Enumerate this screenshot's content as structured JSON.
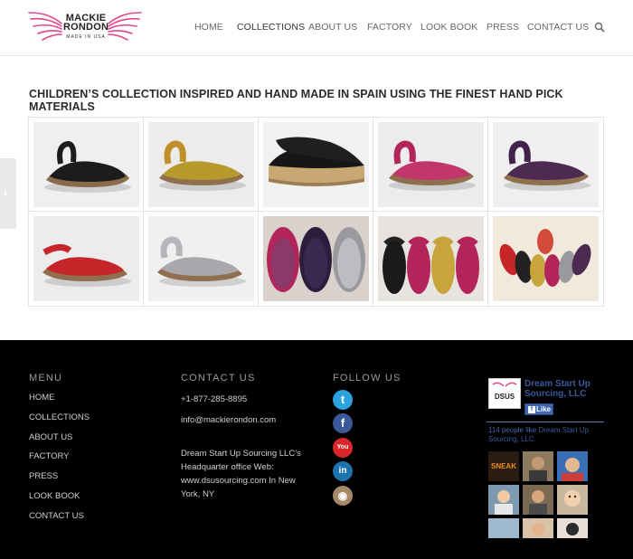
{
  "brand": {
    "line1": "MACKIE",
    "line2": "RONDON",
    "line3": "MADE IN USA",
    "accent": "#e0448d"
  },
  "nav": {
    "items": [
      {
        "label": "HOME",
        "active": false
      },
      {
        "label": "COLLECTIONS",
        "active": true
      },
      {
        "label": "ABOUT US",
        "active": false
      },
      {
        "label": "FACTORY",
        "active": false
      },
      {
        "label": "LOOK BOOK",
        "active": false
      },
      {
        "label": "PRESS",
        "active": false
      },
      {
        "label": "CONTACT US",
        "active": false
      }
    ],
    "search_icon": "search-icon"
  },
  "side_tab": {
    "glyph": "‹"
  },
  "page": {
    "title": "CHILDREN’S COLLECTION INSPIRED AND HAND MADE IN SPAIN USING THE FINEST HAND PICK MATERIALS"
  },
  "gallery": {
    "items": [
      {
        "name": "black-glitter-sandal",
        "color": "#1c1c1c"
      },
      {
        "name": "gold-glitter-sandal",
        "color": "#b89a2c"
      },
      {
        "name": "black-espadrille",
        "color": "#161616"
      },
      {
        "name": "pink-glitter-sandal",
        "color": "#c2376b"
      },
      {
        "name": "purple-sandal",
        "color": "#4d2a52"
      },
      {
        "name": "red-glitter-sandal",
        "color": "#c6262a"
      },
      {
        "name": "silver-glitter-sandal",
        "color": "#a9a9ad"
      },
      {
        "name": "multi-color-sandals-group",
        "color": "#8a3a6a"
      },
      {
        "name": "glitter-sandals-row",
        "color": "#b2245a"
      },
      {
        "name": "rainbow-sandals-circle",
        "color": "#d24b3a"
      }
    ]
  },
  "footer": {
    "menu": {
      "heading": "MENU",
      "items": [
        "HOME",
        "COLLECTIONS",
        "ABOUT US",
        "FACTORY",
        "PRESS",
        "LOOK BOOK",
        "CONTACT US"
      ]
    },
    "contact": {
      "heading": "CONTACT US",
      "phone": "+1-877-285-8895",
      "email": "info@mackierondon.com",
      "address": "Dream Start Up Sourcing LLC’s Headquarter office Web: www.dsusourcing.com In New York, NY"
    },
    "follow": {
      "heading": "FOLLOW US",
      "icons": [
        {
          "name": "twitter-icon",
          "glyph": "t",
          "color": "#2aa3df"
        },
        {
          "name": "facebook-icon",
          "glyph": "f",
          "color": "#3b5998"
        },
        {
          "name": "youtube-icon",
          "glyph": "You",
          "color": "#d8262b"
        },
        {
          "name": "linkedin-icon",
          "glyph": "in",
          "color": "#1d73b0"
        },
        {
          "name": "instagram-icon",
          "glyph": "◉",
          "color": "#a58866"
        }
      ]
    },
    "facebook": {
      "page_name": "Dream Start Up Sourcing, LLC",
      "logo_text": "DSUS",
      "like_label": "Like",
      "likes_text": "114 people like",
      "likes_page": "Dream Start Up Sourcing, LLC."
    }
  }
}
